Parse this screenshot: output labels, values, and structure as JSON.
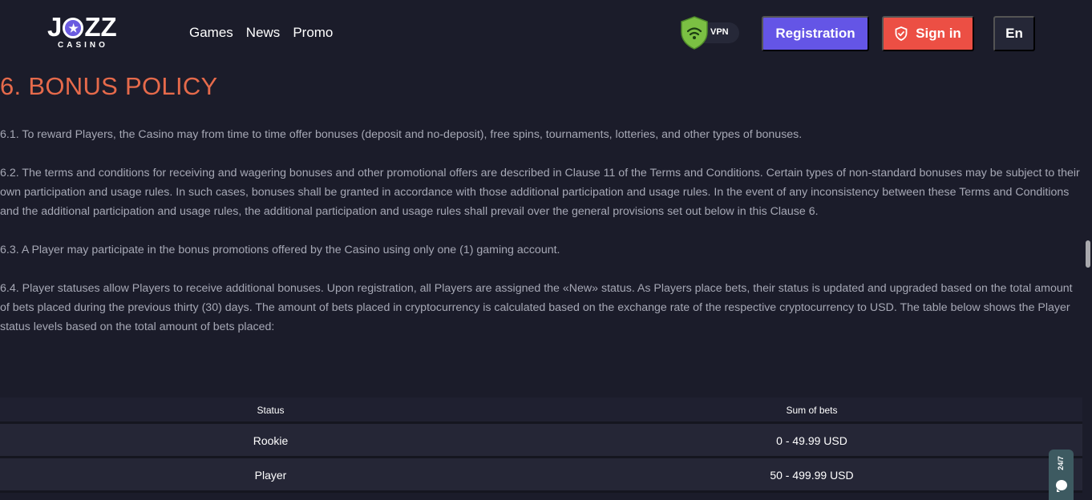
{
  "brand": {
    "logo_main_left": "J",
    "logo_main_right": "ZZ",
    "logo_sub": "CASINO"
  },
  "nav": {
    "items": [
      "Games",
      "News",
      "Promo"
    ]
  },
  "vpn": {
    "label": "VPN"
  },
  "header_buttons": {
    "registration": "Registration",
    "sign_in": "Sign in",
    "language": "En"
  },
  "section": {
    "title": "6. BONUS POLICY",
    "paragraphs": [
      "6.1. To reward Players, the Casino may from time to time offer bonuses (deposit and no-deposit), free spins, tournaments, lotteries, and other types of bonuses.",
      "6.2. The terms and conditions for receiving and wagering bonuses and other promotional offers are described in Clause 11 of the Terms and Conditions. Certain types of non-standard bonuses may be subject to their own participation and usage rules. In such cases, bonuses shall be granted in accordance with those additional participation and usage rules. In the event of any inconsistency between these Terms and Conditions and the additional participation and usage rules, the additional participation and usage rules shall prevail over the general provisions set out below in this Clause 6.",
      "6.3. A Player may participate in the bonus promotions offered by the Casino using only one (1) gaming account.",
      "6.4. Player statuses allow Players to receive additional bonuses. Upon registration, all Players are assigned the «New» status. As Players place bets, their status is updated and upgraded based on the total amount of bets placed during the previous thirty (30) days. The amount of bets placed in cryptocurrency is calculated based on the exchange rate of the respective cryptocurrency to USD. The table below shows the Player status levels based on the total amount of bets placed:"
    ]
  },
  "status_table": {
    "headers": [
      "Status",
      "Sum of bets"
    ],
    "rows": [
      [
        "Rookie",
        "0 - 49.99 USD"
      ],
      [
        "Player",
        "50 - 499.99 USD"
      ]
    ]
  },
  "support_widget": {
    "label": "24/7"
  },
  "colors": {
    "background": "#1b1c2a",
    "accent_title": "#e66a4b",
    "registration_button": "#6455e6",
    "sign_in_button": "#ec4f44",
    "vpn_shield": "#7bc043",
    "support_widget": "#3d5a61"
  }
}
